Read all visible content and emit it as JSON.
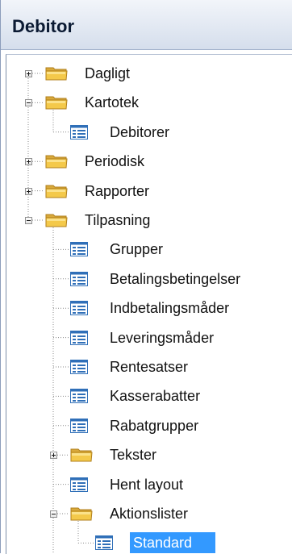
{
  "header": {
    "title": "Debitor"
  },
  "tree": {
    "nodes": [
      {
        "label": "Dagligt",
        "type": "folder",
        "expander": "plus"
      },
      {
        "label": "Kartotek",
        "type": "folder",
        "expander": "minus"
      },
      {
        "label": "Debitorer",
        "type": "form"
      },
      {
        "label": "Periodisk",
        "type": "folder",
        "expander": "plus"
      },
      {
        "label": "Rapporter",
        "type": "folder",
        "expander": "plus"
      },
      {
        "label": "Tilpasning",
        "type": "folder",
        "expander": "minus"
      },
      {
        "label": "Grupper",
        "type": "form"
      },
      {
        "label": "Betalingsbetingelser",
        "type": "form"
      },
      {
        "label": "Indbetalingsmåder",
        "type": "form"
      },
      {
        "label": "Leveringsmåder",
        "type": "form"
      },
      {
        "label": "Rentesatser",
        "type": "form"
      },
      {
        "label": "Kasserabatter",
        "type": "form"
      },
      {
        "label": "Rabatgrupper",
        "type": "form"
      },
      {
        "label": "Tekster",
        "type": "folder",
        "expander": "plus"
      },
      {
        "label": "Hent layout",
        "type": "form"
      },
      {
        "label": "Aktionslister",
        "type": "folder",
        "expander": "minus"
      },
      {
        "label": "Standard",
        "type": "form",
        "selected": true
      }
    ]
  },
  "colors": {
    "selection": "#3399ff",
    "folder_yellow": "#f4c94a",
    "form_icon_blue": "#2f6fb8"
  },
  "icons": {
    "folder": "folder-icon",
    "form": "form-icon",
    "expand": "plus-expander-icon",
    "collapse": "minus-expander-icon"
  }
}
